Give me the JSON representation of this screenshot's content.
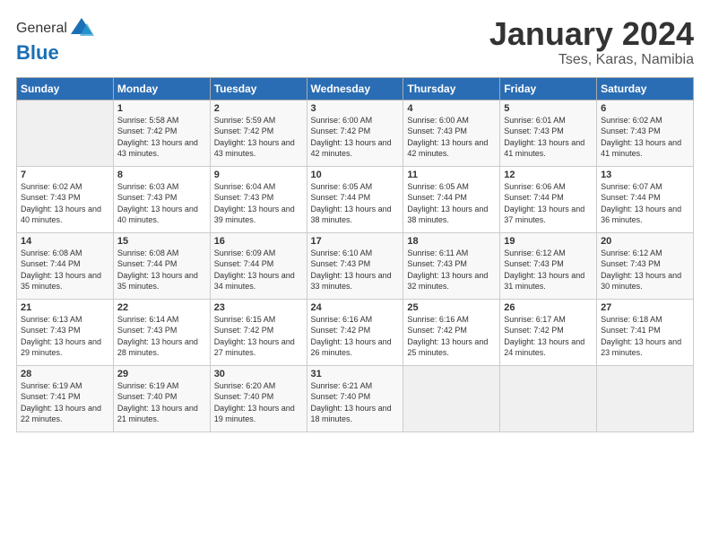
{
  "logo": {
    "general": "General",
    "blue": "Blue"
  },
  "header": {
    "title": "January 2024",
    "subtitle": "Tses, Karas, Namibia"
  },
  "weekdays": [
    "Sunday",
    "Monday",
    "Tuesday",
    "Wednesday",
    "Thursday",
    "Friday",
    "Saturday"
  ],
  "weeks": [
    [
      {
        "day": "",
        "sunrise": "",
        "sunset": "",
        "daylight": ""
      },
      {
        "day": "1",
        "sunrise": "Sunrise: 5:58 AM",
        "sunset": "Sunset: 7:42 PM",
        "daylight": "Daylight: 13 hours and 43 minutes."
      },
      {
        "day": "2",
        "sunrise": "Sunrise: 5:59 AM",
        "sunset": "Sunset: 7:42 PM",
        "daylight": "Daylight: 13 hours and 43 minutes."
      },
      {
        "day": "3",
        "sunrise": "Sunrise: 6:00 AM",
        "sunset": "Sunset: 7:42 PM",
        "daylight": "Daylight: 13 hours and 42 minutes."
      },
      {
        "day": "4",
        "sunrise": "Sunrise: 6:00 AM",
        "sunset": "Sunset: 7:43 PM",
        "daylight": "Daylight: 13 hours and 42 minutes."
      },
      {
        "day": "5",
        "sunrise": "Sunrise: 6:01 AM",
        "sunset": "Sunset: 7:43 PM",
        "daylight": "Daylight: 13 hours and 41 minutes."
      },
      {
        "day": "6",
        "sunrise": "Sunrise: 6:02 AM",
        "sunset": "Sunset: 7:43 PM",
        "daylight": "Daylight: 13 hours and 41 minutes."
      }
    ],
    [
      {
        "day": "7",
        "sunrise": "Sunrise: 6:02 AM",
        "sunset": "Sunset: 7:43 PM",
        "daylight": "Daylight: 13 hours and 40 minutes."
      },
      {
        "day": "8",
        "sunrise": "Sunrise: 6:03 AM",
        "sunset": "Sunset: 7:43 PM",
        "daylight": "Daylight: 13 hours and 40 minutes."
      },
      {
        "day": "9",
        "sunrise": "Sunrise: 6:04 AM",
        "sunset": "Sunset: 7:43 PM",
        "daylight": "Daylight: 13 hours and 39 minutes."
      },
      {
        "day": "10",
        "sunrise": "Sunrise: 6:05 AM",
        "sunset": "Sunset: 7:44 PM",
        "daylight": "Daylight: 13 hours and 38 minutes."
      },
      {
        "day": "11",
        "sunrise": "Sunrise: 6:05 AM",
        "sunset": "Sunset: 7:44 PM",
        "daylight": "Daylight: 13 hours and 38 minutes."
      },
      {
        "day": "12",
        "sunrise": "Sunrise: 6:06 AM",
        "sunset": "Sunset: 7:44 PM",
        "daylight": "Daylight: 13 hours and 37 minutes."
      },
      {
        "day": "13",
        "sunrise": "Sunrise: 6:07 AM",
        "sunset": "Sunset: 7:44 PM",
        "daylight": "Daylight: 13 hours and 36 minutes."
      }
    ],
    [
      {
        "day": "14",
        "sunrise": "Sunrise: 6:08 AM",
        "sunset": "Sunset: 7:44 PM",
        "daylight": "Daylight: 13 hours and 35 minutes."
      },
      {
        "day": "15",
        "sunrise": "Sunrise: 6:08 AM",
        "sunset": "Sunset: 7:44 PM",
        "daylight": "Daylight: 13 hours and 35 minutes."
      },
      {
        "day": "16",
        "sunrise": "Sunrise: 6:09 AM",
        "sunset": "Sunset: 7:44 PM",
        "daylight": "Daylight: 13 hours and 34 minutes."
      },
      {
        "day": "17",
        "sunrise": "Sunrise: 6:10 AM",
        "sunset": "Sunset: 7:43 PM",
        "daylight": "Daylight: 13 hours and 33 minutes."
      },
      {
        "day": "18",
        "sunrise": "Sunrise: 6:11 AM",
        "sunset": "Sunset: 7:43 PM",
        "daylight": "Daylight: 13 hours and 32 minutes."
      },
      {
        "day": "19",
        "sunrise": "Sunrise: 6:12 AM",
        "sunset": "Sunset: 7:43 PM",
        "daylight": "Daylight: 13 hours and 31 minutes."
      },
      {
        "day": "20",
        "sunrise": "Sunrise: 6:12 AM",
        "sunset": "Sunset: 7:43 PM",
        "daylight": "Daylight: 13 hours and 30 minutes."
      }
    ],
    [
      {
        "day": "21",
        "sunrise": "Sunrise: 6:13 AM",
        "sunset": "Sunset: 7:43 PM",
        "daylight": "Daylight: 13 hours and 29 minutes."
      },
      {
        "day": "22",
        "sunrise": "Sunrise: 6:14 AM",
        "sunset": "Sunset: 7:43 PM",
        "daylight": "Daylight: 13 hours and 28 minutes."
      },
      {
        "day": "23",
        "sunrise": "Sunrise: 6:15 AM",
        "sunset": "Sunset: 7:42 PM",
        "daylight": "Daylight: 13 hours and 27 minutes."
      },
      {
        "day": "24",
        "sunrise": "Sunrise: 6:16 AM",
        "sunset": "Sunset: 7:42 PM",
        "daylight": "Daylight: 13 hours and 26 minutes."
      },
      {
        "day": "25",
        "sunrise": "Sunrise: 6:16 AM",
        "sunset": "Sunset: 7:42 PM",
        "daylight": "Daylight: 13 hours and 25 minutes."
      },
      {
        "day": "26",
        "sunrise": "Sunrise: 6:17 AM",
        "sunset": "Sunset: 7:42 PM",
        "daylight": "Daylight: 13 hours and 24 minutes."
      },
      {
        "day": "27",
        "sunrise": "Sunrise: 6:18 AM",
        "sunset": "Sunset: 7:41 PM",
        "daylight": "Daylight: 13 hours and 23 minutes."
      }
    ],
    [
      {
        "day": "28",
        "sunrise": "Sunrise: 6:19 AM",
        "sunset": "Sunset: 7:41 PM",
        "daylight": "Daylight: 13 hours and 22 minutes."
      },
      {
        "day": "29",
        "sunrise": "Sunrise: 6:19 AM",
        "sunset": "Sunset: 7:40 PM",
        "daylight": "Daylight: 13 hours and 21 minutes."
      },
      {
        "day": "30",
        "sunrise": "Sunrise: 6:20 AM",
        "sunset": "Sunset: 7:40 PM",
        "daylight": "Daylight: 13 hours and 19 minutes."
      },
      {
        "day": "31",
        "sunrise": "Sunrise: 6:21 AM",
        "sunset": "Sunset: 7:40 PM",
        "daylight": "Daylight: 13 hours and 18 minutes."
      },
      {
        "day": "",
        "sunrise": "",
        "sunset": "",
        "daylight": ""
      },
      {
        "day": "",
        "sunrise": "",
        "sunset": "",
        "daylight": ""
      },
      {
        "day": "",
        "sunrise": "",
        "sunset": "",
        "daylight": ""
      }
    ]
  ]
}
